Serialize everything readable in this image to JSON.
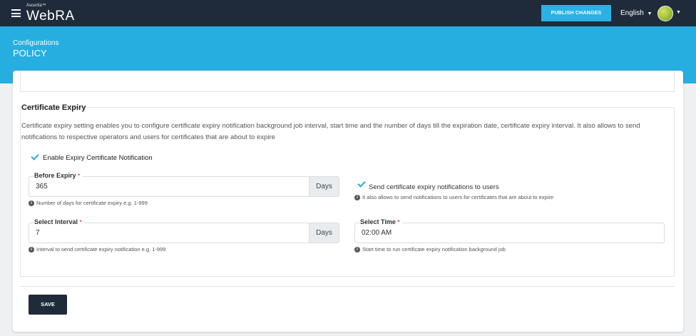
{
  "topbar": {
    "brand_small": "Ascertia™",
    "brand_name": "WebRA",
    "publish_label": "PUBLISH CHANGES",
    "language": "English",
    "caret": "▼"
  },
  "banner": {
    "breadcrumb": "Configurations",
    "title": "POLICY"
  },
  "certificate_expiry": {
    "title": "Certificate Expiry",
    "description": "Certificate expiry setting enables you to configure certificate expiry notification background job interval, start time and the number of days till the expiration date, certificate expiry interval. It also allows to send notifications to respective operators and users for certificates that are about to expire",
    "enable_label": "Enable Expiry Certificate Notification",
    "enable_checked": true,
    "before_expiry": {
      "label": "Before Expiry",
      "required_mark": "*",
      "value": "365",
      "addon": "Days",
      "hint": "Number of days for certificate expiry e.g. 1-999"
    },
    "send_users": {
      "label": "Send certificate expiry notifications to users",
      "checked": true,
      "hint": "It also allows to send notifications to users for certificates that are about to expire"
    },
    "select_interval": {
      "label": "Select Interval",
      "required_mark": "*",
      "value": "7",
      "addon": "Days",
      "hint": "Interval to send certificate expiry notification e.g. 1-999"
    },
    "select_time": {
      "label": "Select Time",
      "required_mark": "*",
      "value": "02:00 AM",
      "hint": "Start time to run certificate expiry notification background job"
    }
  },
  "footer": {
    "save_label": "SAVE"
  },
  "info_glyph": "i",
  "colors": {
    "topbar": "#1f2a3a",
    "accent": "#26aee0",
    "button": "#29b2e3",
    "required": "#d9534f"
  }
}
